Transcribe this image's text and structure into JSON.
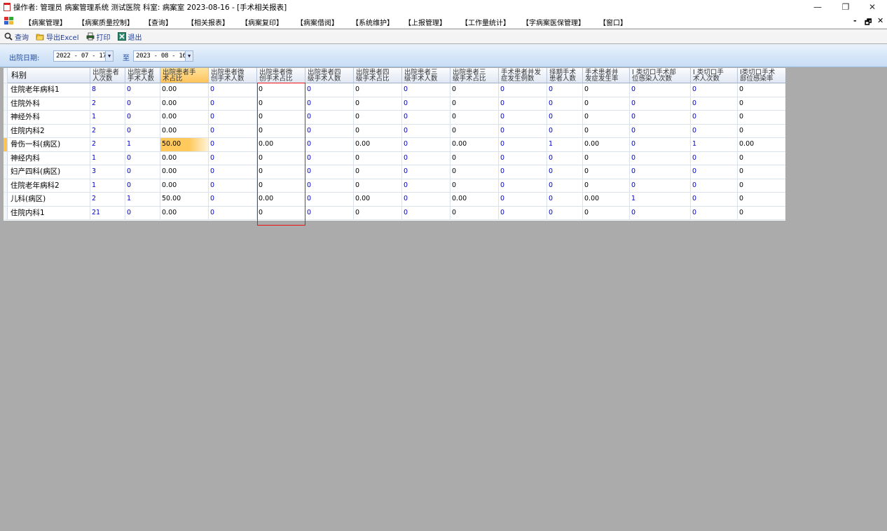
{
  "window": {
    "title": "操作者: 管理员 病案管理系统 测试医院 科室: 病案室 2023-08-16 - [手术相关报表]",
    "controls": {
      "minimize": "—",
      "restore": "❐",
      "close": "✕"
    }
  },
  "menu": {
    "items": [
      "【病案管理】",
      "【病案质量控制】",
      "【查询】",
      "【相关报表】",
      "【病案复印】",
      "【病案借阅】",
      "【系统维护】",
      "【上报管理】",
      "【工作量统计】",
      "【字病案医保管理】",
      "【窗口】"
    ],
    "mdi_controls": {
      "minimize": "-",
      "restore": "🗗",
      "close": "✕"
    }
  },
  "toolbar": {
    "query": "查询",
    "export": "导出Excel",
    "print": "打印",
    "exit": "退出"
  },
  "filter": {
    "label": "出院日期:",
    "from": "2022 - 07 - 17",
    "separator": "至",
    "to": "2023 - 08 - 16"
  },
  "grid": {
    "columns": [
      {
        "l1": "科别",
        "l2": ""
      },
      {
        "l1": "出院患者",
        "l2": "人次数"
      },
      {
        "l1": "出院患者",
        "l2": "手术人数"
      },
      {
        "l1": "出院患者手",
        "l2": "术占比"
      },
      {
        "l1": "出院患者微",
        "l2": "创手术人数"
      },
      {
        "l1": "出院患者微",
        "l2": "创手术占比"
      },
      {
        "l1": "出院患者四",
        "l2": "级手术人数"
      },
      {
        "l1": "出院患者四",
        "l2": "级手术占比"
      },
      {
        "l1": "出院患者三",
        "l2": "级手术人数"
      },
      {
        "l1": "出院患者三",
        "l2": "级手术占比"
      },
      {
        "l1": "手术患者并发",
        "l2": "症发生例数"
      },
      {
        "l1": "择期手术",
        "l2": "患者人数"
      },
      {
        "l1": "手术患者并",
        "l2": "发症发生率"
      },
      {
        "l1": "I 类切口手术部",
        "l2": "位感染人次数"
      },
      {
        "l1": "I 类切口手",
        "l2": "术人次数"
      },
      {
        "l1": "I类切口手术",
        "l2": "部位感染率"
      }
    ],
    "rows": [
      [
        "住院老年病科1",
        "8",
        "0",
        "0.00",
        "0",
        "0",
        "0",
        "0",
        "0",
        "0",
        "0",
        "0",
        "0",
        "0",
        "0",
        "0"
      ],
      [
        "住院外科",
        "2",
        "0",
        "0.00",
        "0",
        "0",
        "0",
        "0",
        "0",
        "0",
        "0",
        "0",
        "0",
        "0",
        "0",
        "0"
      ],
      [
        "神经外科",
        "1",
        "0",
        "0.00",
        "0",
        "0",
        "0",
        "0",
        "0",
        "0",
        "0",
        "0",
        "0",
        "0",
        "0",
        "0"
      ],
      [
        "住院内科2",
        "2",
        "0",
        "0.00",
        "0",
        "0",
        "0",
        "0",
        "0",
        "0",
        "0",
        "0",
        "0",
        "0",
        "0",
        "0"
      ],
      [
        "骨伤一科(病区)",
        "2",
        "1",
        "50.00",
        "0",
        "0.00",
        "0",
        "0.00",
        "0",
        "0.00",
        "0",
        "1",
        "0.00",
        "0",
        "1",
        "0.00"
      ],
      [
        "神经内科",
        "1",
        "0",
        "0.00",
        "0",
        "0",
        "0",
        "0",
        "0",
        "0",
        "0",
        "0",
        "0",
        "0",
        "0",
        "0"
      ],
      [
        "妇产四科(病区)",
        "3",
        "0",
        "0.00",
        "0",
        "0",
        "0",
        "0",
        "0",
        "0",
        "0",
        "0",
        "0",
        "0",
        "0",
        "0"
      ],
      [
        "住院老年病科2",
        "1",
        "0",
        "0.00",
        "0",
        "0",
        "0",
        "0",
        "0",
        "0",
        "0",
        "0",
        "0",
        "0",
        "0",
        "0"
      ],
      [
        "儿科(病区)",
        "2",
        "1",
        "50.00",
        "0",
        "0.00",
        "0",
        "0.00",
        "0",
        "0.00",
        "0",
        "0",
        "0.00",
        "1",
        "0",
        "0"
      ],
      [
        "住院内科1",
        "21",
        "0",
        "0.00",
        "0",
        "0",
        "0",
        "0",
        "0",
        "0",
        "0",
        "0",
        "0",
        "0",
        "0",
        "0"
      ]
    ],
    "selected_row": 4,
    "active_column": 3
  },
  "colors": {
    "accent_blue": "#0000cc",
    "highlight": "#ffc35c",
    "annotation_red": "#e11111"
  }
}
